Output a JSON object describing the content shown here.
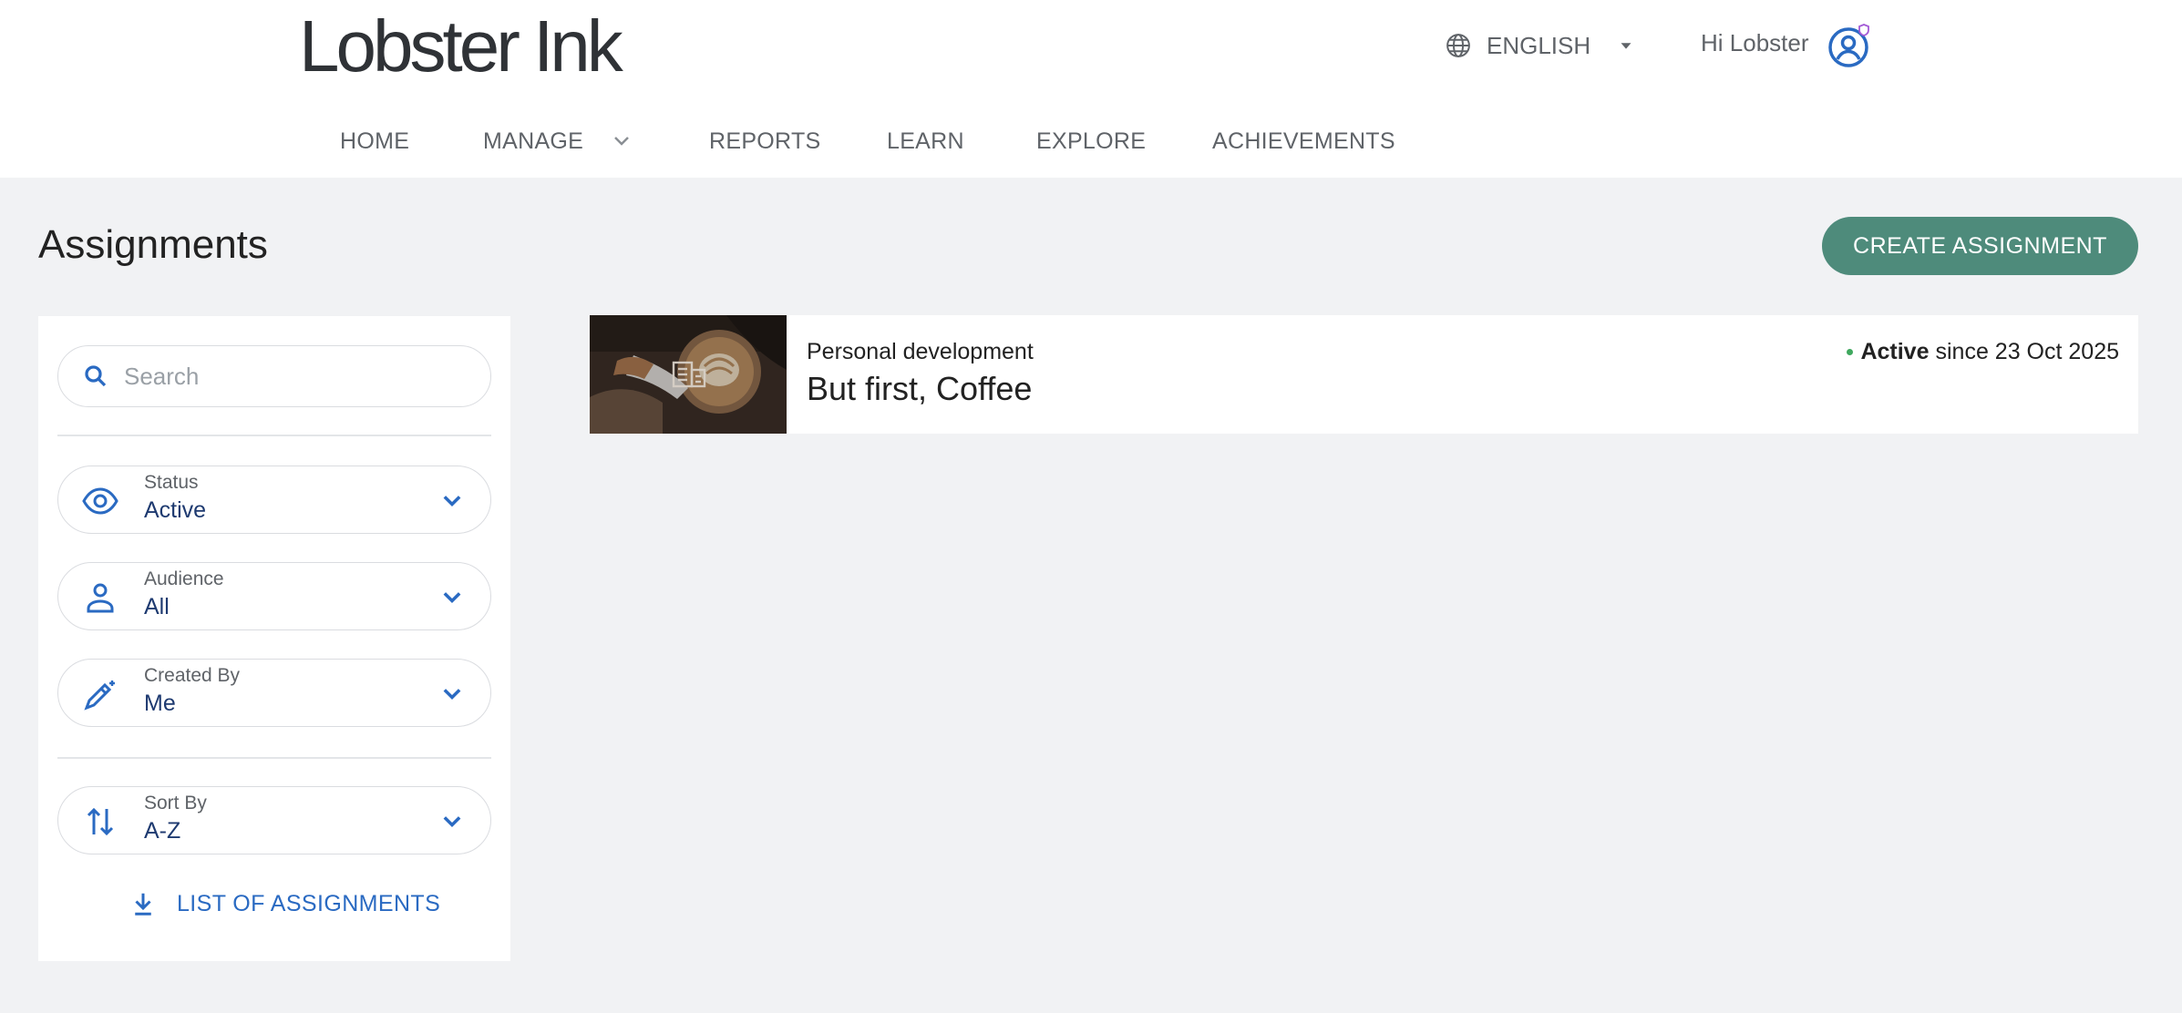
{
  "brand": {
    "logo_text": "Lobster Ink"
  },
  "header": {
    "language": "ENGLISH",
    "greeting": "Hi Lobster"
  },
  "nav": {
    "home": "HOME",
    "manage": "MANAGE",
    "reports": "REPORTS",
    "learn": "LEARN",
    "explore": "EXPLORE",
    "achievements": "ACHIEVEMENTS"
  },
  "page": {
    "title": "Assignments",
    "create_button": "CREATE ASSIGNMENT"
  },
  "sidebar": {
    "search_placeholder": "Search",
    "filters": {
      "status": {
        "label": "Status",
        "value": "Active",
        "icon": "eye-icon"
      },
      "audience": {
        "label": "Audience",
        "value": "All",
        "icon": "person-icon"
      },
      "created_by": {
        "label": "Created By",
        "value": "Me",
        "icon": "pencil-sparkle-icon"
      },
      "sort_by": {
        "label": "Sort By",
        "value": "A-Z",
        "icon": "swap-vertical-icon"
      }
    },
    "download_label": "LIST OF ASSIGNMENTS"
  },
  "assignments": [
    {
      "category": "Personal development",
      "title": "But first, Coffee",
      "status": "Active",
      "since_text": "since 23 Oct 2025"
    }
  ],
  "colors": {
    "accent_button": "#4e8b7b",
    "link_blue": "#2a6ac2",
    "status_green": "#3fa85e",
    "page_background": "#f1f2f4"
  }
}
